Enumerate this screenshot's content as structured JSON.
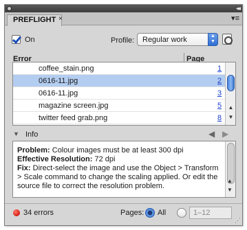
{
  "panel": {
    "tab_label": "PREFLIGHT",
    "tab_close_glyph": "×",
    "menu_glyph": "▾≡",
    "collapse_glyph": "◂◂"
  },
  "controls": {
    "on_label": "On",
    "on_checked": true,
    "profile_label": "Profile:",
    "profile_value": "Regular work",
    "profile_icon": "profile-icon"
  },
  "table": {
    "headers": [
      "Error",
      "Page"
    ],
    "rows": [
      {
        "name": "coffee_stain.png",
        "page": "1",
        "selected": false
      },
      {
        "name": "0616-11.jpg",
        "page": "2",
        "selected": true
      },
      {
        "name": "0616-11.jpg",
        "page": "3",
        "selected": false
      },
      {
        "name": "magazine screen.jpg",
        "page": "5",
        "selected": false
      },
      {
        "name": "twitter feed grab.png",
        "page": "8",
        "selected": false
      }
    ]
  },
  "info": {
    "label": "Info",
    "problem_label": "Problem:",
    "problem_text": " Colour images must be at least 300 dpi",
    "resolution_label": "Effective Resolution:",
    "resolution_text": " 72 dpi",
    "fix_label": "Fix:",
    "fix_text": " Direct-select the image and use the Object > Transform > Scale command to change the scaling applied. Or edit the source file to correct the resolution problem."
  },
  "footer": {
    "error_count": "34 errors",
    "status_color": "#d41a10",
    "pages_label": "Pages:",
    "all_label": "All",
    "all_selected": true,
    "range_value": "1–12"
  },
  "colors": {
    "selection": "#b3cdf0",
    "accent": "#2f6ed4",
    "link": "#1a3fd0"
  }
}
